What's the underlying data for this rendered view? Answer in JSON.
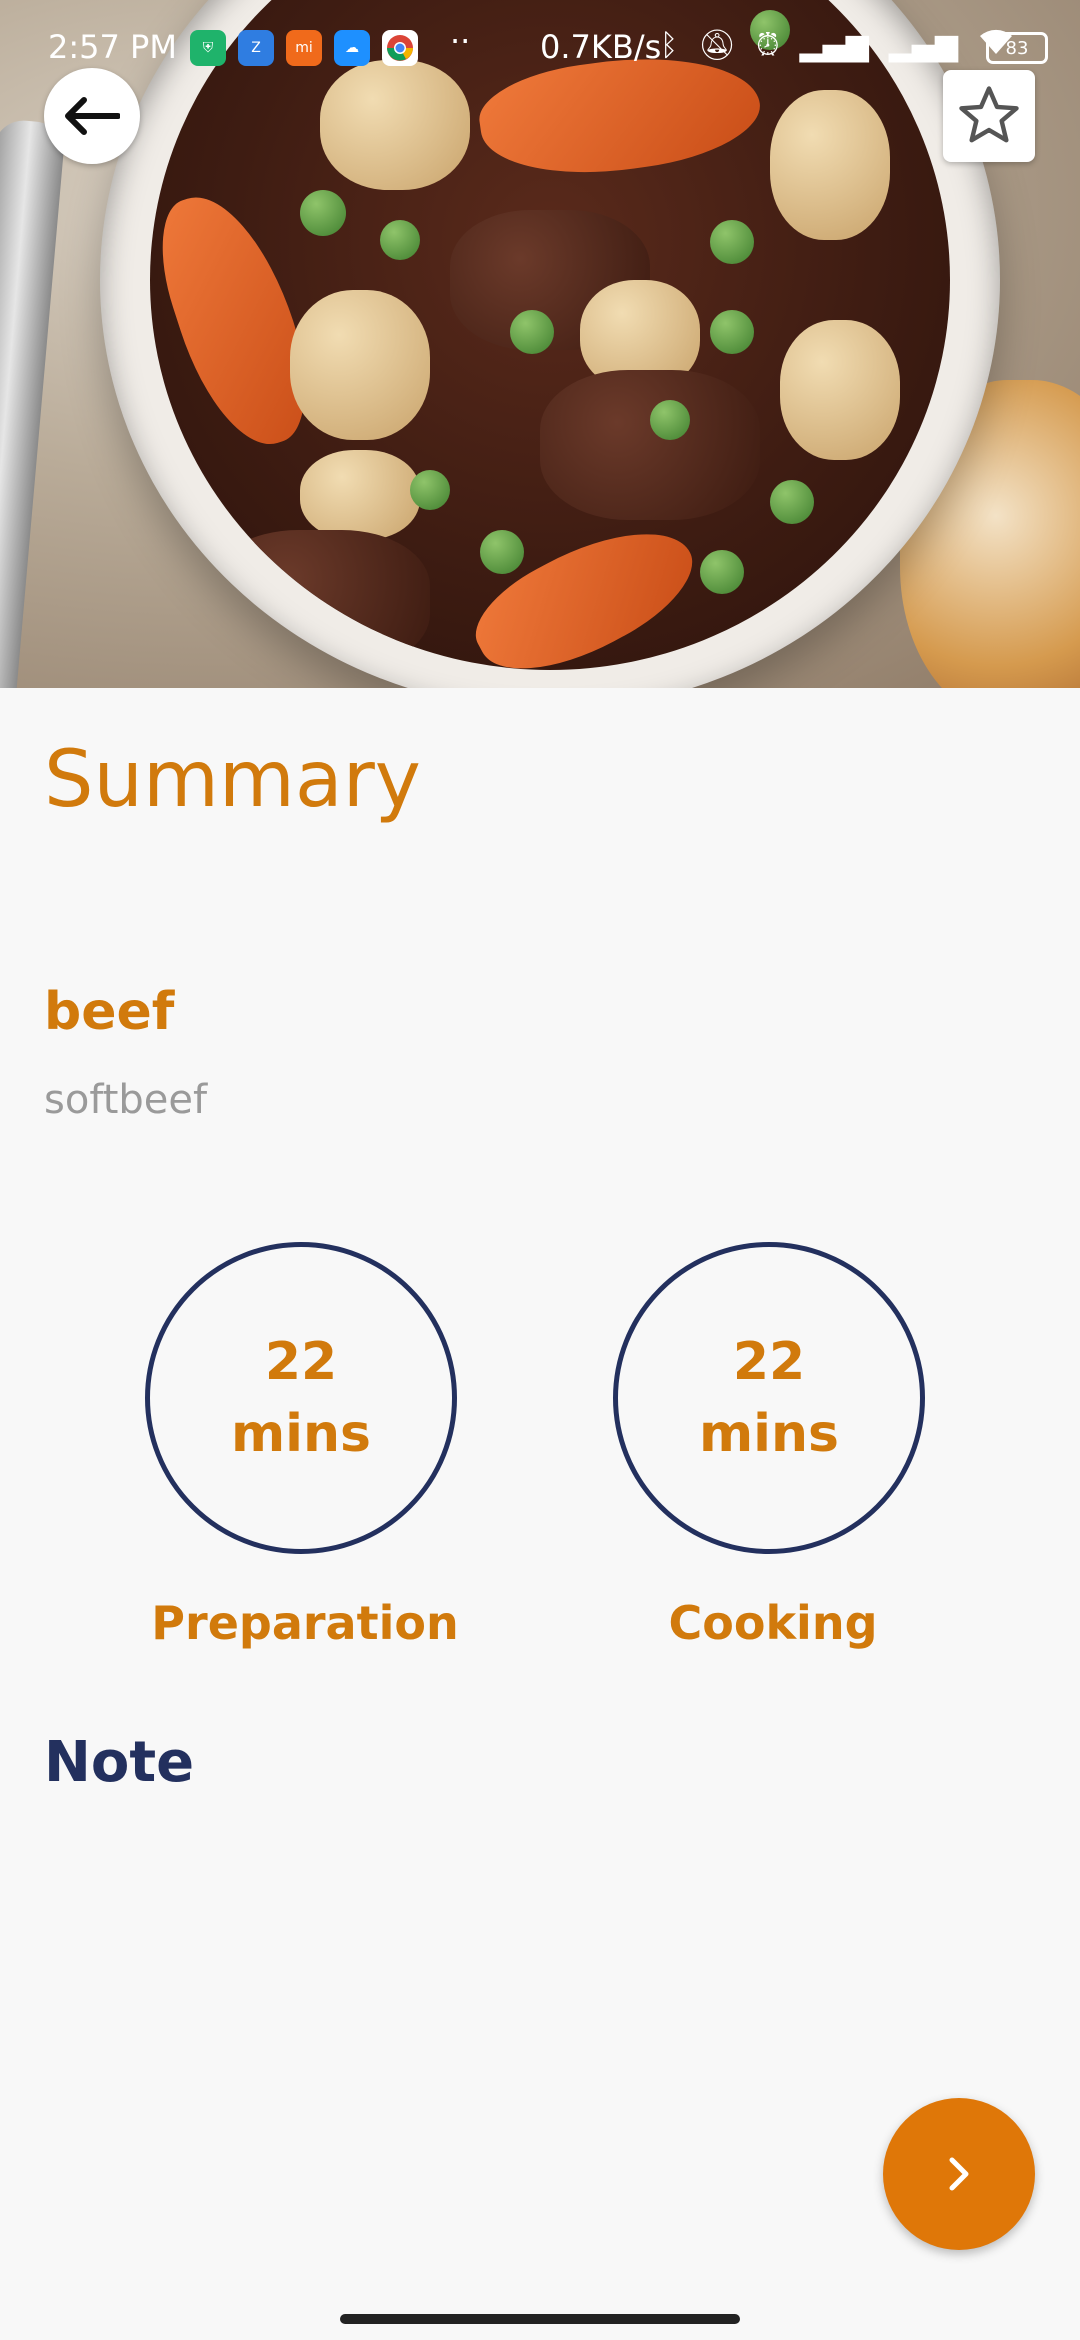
{
  "status_bar": {
    "time": "2:57 PM",
    "network_speed": "0.7KB/s",
    "battery": "83",
    "dots": "··",
    "icons": [
      "shield-app-icon",
      "zalo-app-icon",
      "mi-app-icon",
      "cloud-app-icon",
      "chrome-app-icon",
      "bluetooth-icon",
      "mute-icon",
      "alarm-icon",
      "signal-icon",
      "signal-icon",
      "wifi-icon",
      "battery-icon"
    ]
  },
  "hero": {
    "back_icon": "arrow-left-icon",
    "favorite_icon": "star-outline-icon"
  },
  "summary": {
    "title": "Summary",
    "name": "beef",
    "description": "softbeef"
  },
  "times": [
    {
      "value": "22",
      "unit": "mins",
      "label": "Preparation"
    },
    {
      "value": "22",
      "unit": "mins",
      "label": "Cooking"
    }
  ],
  "note": {
    "title": "Note"
  },
  "fab": {
    "icon": "chevron-right-icon"
  },
  "colors": {
    "accent": "#d17a0c",
    "navy": "#23305e",
    "fab": "#df7708",
    "background": "#f8f8f8"
  }
}
